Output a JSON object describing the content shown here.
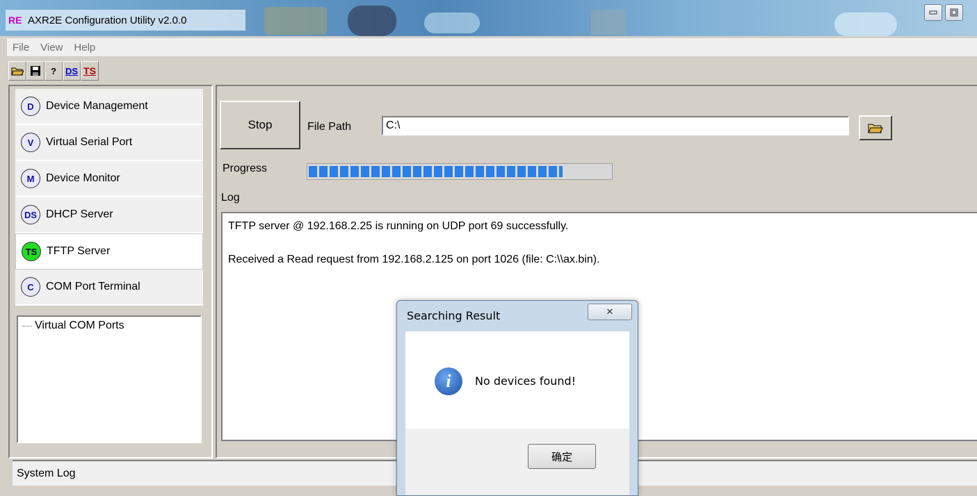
{
  "window": {
    "title": "AXR2E Configuration Utility v2.0.0",
    "icon_text": "RE"
  },
  "menu": [
    "File",
    "View",
    "Help"
  ],
  "toolbar": {
    "ds_label": "DS",
    "ts_label": "TS"
  },
  "nav": {
    "items": [
      {
        "badge": "D",
        "label": "Device Management"
      },
      {
        "badge": "V",
        "label": "Virtual Serial Port"
      },
      {
        "badge": "M",
        "label": "Device Monitor"
      },
      {
        "badge": "DS",
        "label": "DHCP Server"
      },
      {
        "badge": "TS",
        "label": "TFTP Server"
      },
      {
        "badge": "C",
        "label": "COM Port Terminal"
      }
    ],
    "active": "TFTP Server"
  },
  "tree": {
    "items": [
      "Virtual COM Ports"
    ]
  },
  "tftp": {
    "stop_label": "Stop",
    "file_path_label": "File Path",
    "file_path_value": "C:\\",
    "progress_label": "Progress",
    "progress_fraction": 0.84,
    "log_label": "Log",
    "log_lines": [
      "TFTP server @ 192.168.2.25 is running on UDP port 69 successfully.",
      "Received a Read request from 192.168.2.125 on port 1026 (file: C:\\\\ax.bin)."
    ]
  },
  "status": {
    "label": "System Log"
  },
  "dialog": {
    "title": "Searching Result",
    "message": "No devices found!",
    "ok_label": "确定",
    "close_glyph": "✕",
    "icon": "info-icon",
    "icon_glyph": "i"
  }
}
